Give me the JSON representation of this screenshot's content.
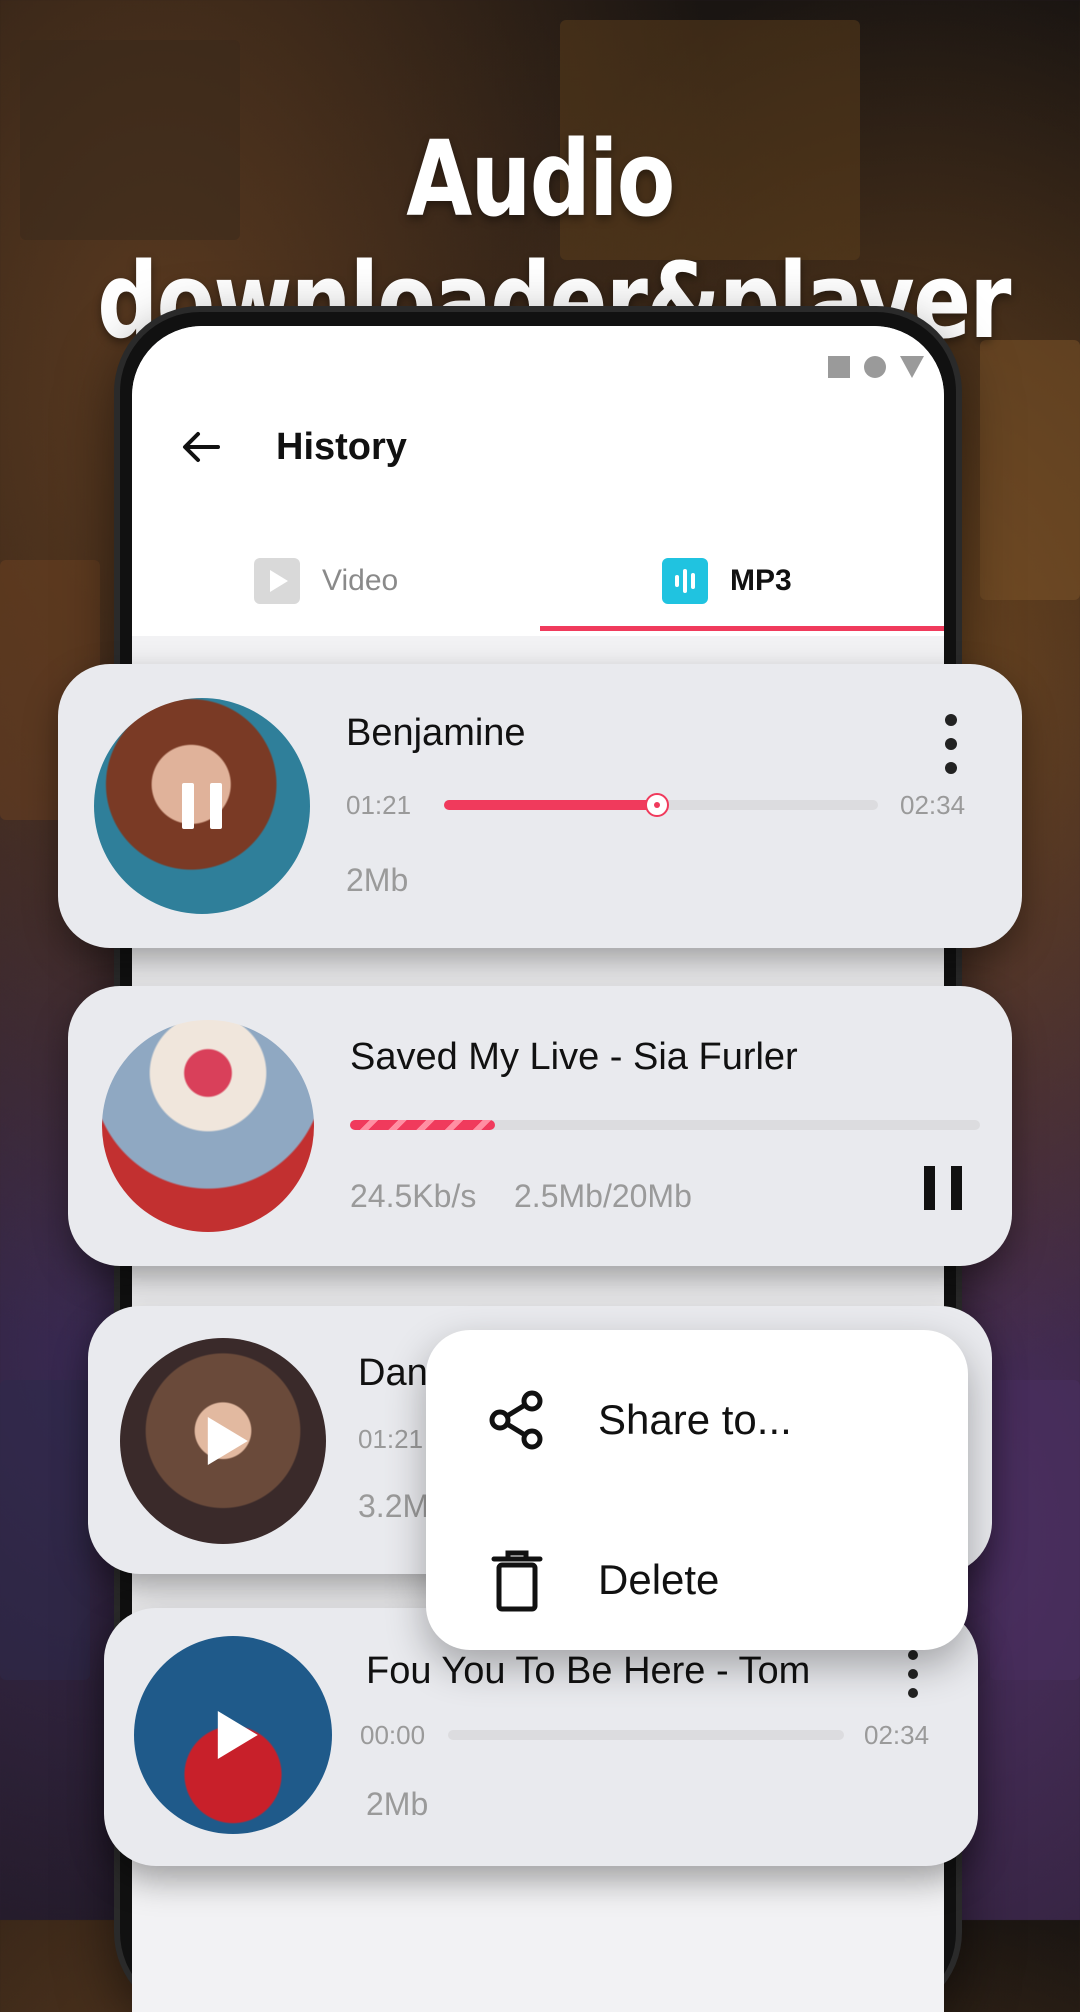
{
  "headline": "Audio downloader&player",
  "header": {
    "title": "History"
  },
  "tabs": [
    {
      "label": "Video",
      "icon": "video-icon",
      "active": false
    },
    {
      "label": "MP3",
      "icon": "mp3-icon",
      "active": true
    }
  ],
  "colors": {
    "accent": "#f03a5c",
    "mp3_icon": "#20c3e0",
    "card_bg": "#e9eaee"
  },
  "items": [
    {
      "title": "Benjamine",
      "elapsed": "01:21",
      "duration": "02:34",
      "size": "2Mb",
      "progress": 0.49,
      "state": "playing"
    },
    {
      "title": "Saved My Live - Sia Furler",
      "speed": "24.5Kb/s",
      "downloaded": "2.5Mb/20Mb",
      "progress": 0.23,
      "state": "downloading"
    },
    {
      "title": "Dani",
      "elapsed": "01:21",
      "size": "3.2M",
      "state": "paused"
    },
    {
      "title": "Fou You To Be Here - Tom",
      "elapsed": "00:00",
      "duration": "02:34",
      "size": "2Mb",
      "progress": 0,
      "state": "paused"
    }
  ],
  "context_menu": {
    "share_label": "Share to...",
    "delete_label": "Delete"
  }
}
